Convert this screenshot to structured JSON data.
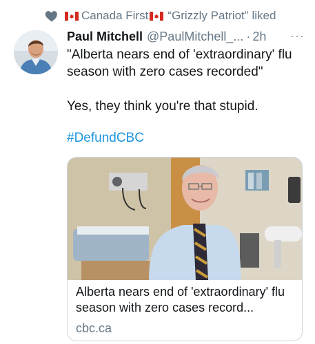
{
  "social_context": {
    "account": "Canada First",
    "liker": "“Grizzly Patriot”",
    "action": "liked"
  },
  "tweet": {
    "name": "Paul Mitchell",
    "handle": "@PaulMitchell_...",
    "separator": "·",
    "time": "2h",
    "more": "···",
    "line1": "\"Alberta nears end of 'extraordinary' flu season with zero cases recorded\"",
    "line2": "Yes, they think you're that stupid.",
    "hashtag": "#DefundCBC"
  },
  "link_card": {
    "title": "Alberta nears end of 'extraordinary' flu season with zero cases record...",
    "domain": "cbc.ca"
  },
  "icons": {
    "like": "heart-icon",
    "flag": "canada-flag-icon",
    "menu": "more-options-icon"
  },
  "colors": {
    "link": "#1b95e0",
    "secondary_text": "#657786",
    "flag_red": "#d52b1e"
  }
}
